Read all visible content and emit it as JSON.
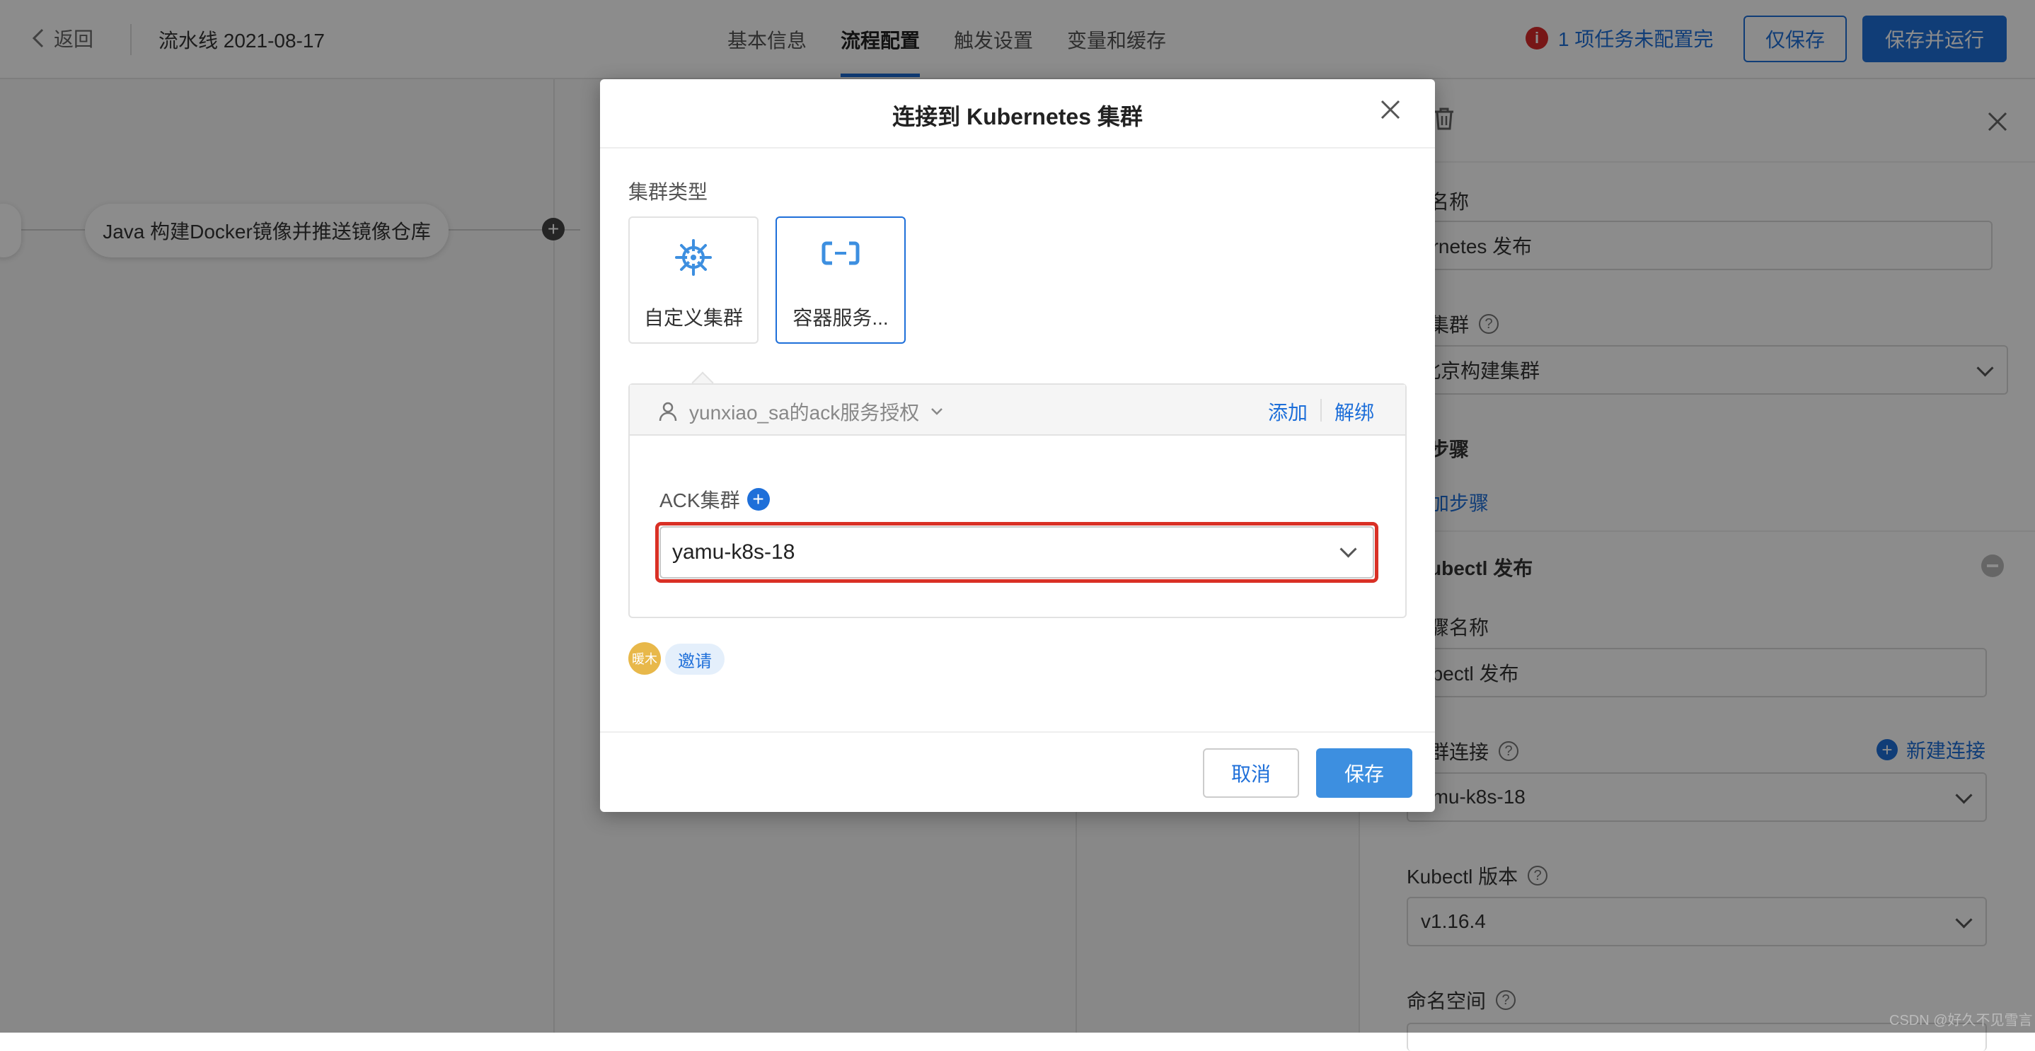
{
  "header": {
    "back_label": "返回",
    "pipeline_title": "流水线 2021-08-17",
    "tabs": [
      {
        "label": "基本信息"
      },
      {
        "label": "流程配置"
      },
      {
        "label": "触发设置"
      },
      {
        "label": "变量和缓存"
      }
    ],
    "warning_text": "1 项任务未配置完",
    "warning_icon_char": "i",
    "save_only_label": "仅保存",
    "save_run_label": "保存并运行"
  },
  "canvas": {
    "stage_label": "Java 构建Docker镜像并推送镜像仓库",
    "add_symbol": "+"
  },
  "right_panel": {
    "name_label": "名称",
    "name_value": "ernetes 发布",
    "cluster_label": "集群",
    "cluster_value": "北京构建集群",
    "steps_label": "步骤",
    "add_step_label": "加步骤",
    "kubectl_section_title": "ubectl 发布",
    "step_name_label": "骤名称",
    "step_name_value": "ubectl 发布",
    "cluster_conn_label": "群连接",
    "new_conn_label": "新建连接",
    "cluster_conn_value": "amu-k8s-18",
    "kubectl_version_label": "Kubectl 版本",
    "kubectl_version_value": "v1.16.4",
    "namespace_label": "命名空间",
    "help_char": "?"
  },
  "modal": {
    "title": "连接到 Kubernetes 集群",
    "cluster_type_label": "集群类型",
    "cards": [
      {
        "label": "自定义集群",
        "icon": "helm-wheel-icon"
      },
      {
        "label": "容器服务...",
        "icon": "aliyun-icon"
      }
    ],
    "auth_user": "yunxiao_sa的ack服务授权",
    "add_label": "添加",
    "unbind_label": "解绑",
    "ack_label": "ACK集群",
    "ack_value": "yamu-k8s-18",
    "avatar_text": "暖木",
    "invite_label": "邀请",
    "cancel_label": "取消",
    "save_label": "保存"
  },
  "watermark": "CSDN @好久不见雪言",
  "colors": {
    "accent": "#1e6fd9",
    "highlight_frame": "#d93025",
    "overlay": "rgba(0,0,0,0.45)"
  }
}
